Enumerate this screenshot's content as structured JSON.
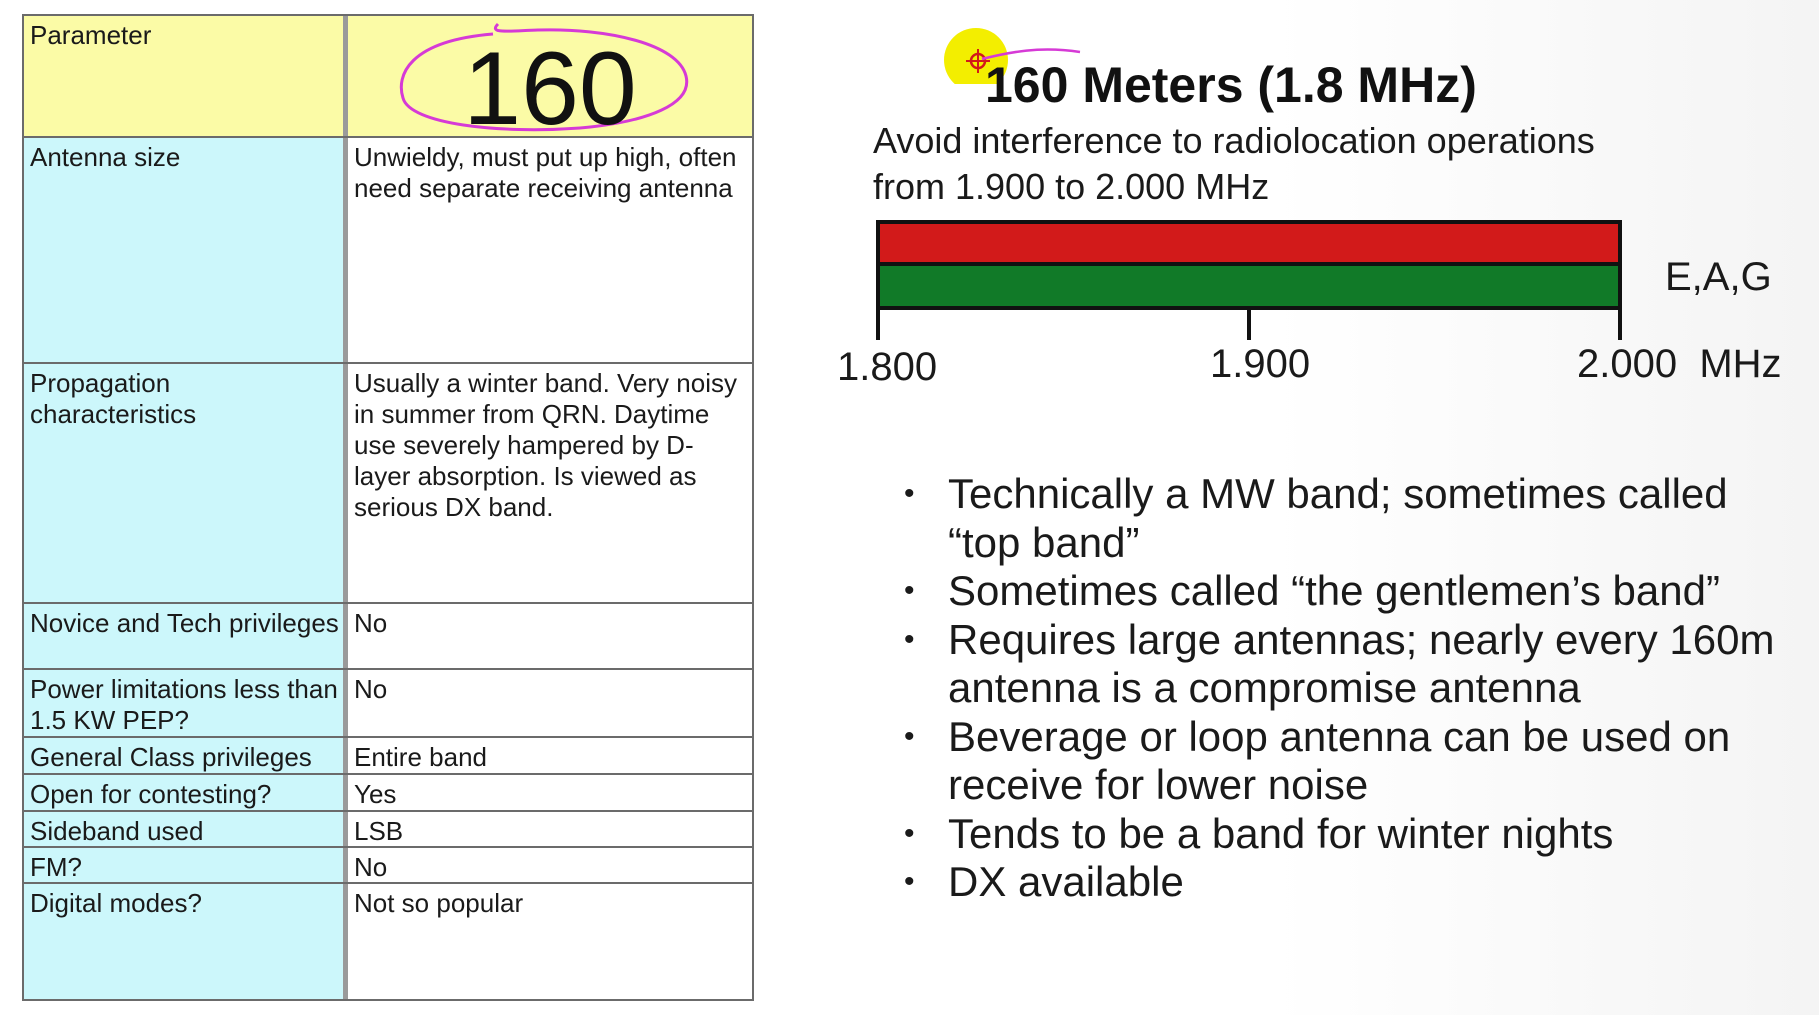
{
  "table": {
    "header": {
      "param_label": "Parameter",
      "band": "160"
    },
    "rows": [
      {
        "label": "Antenna size",
        "value": "Unwieldy, must put up high, often need separate receiving antenna"
      },
      {
        "label": "Propagation characteristics",
        "value": "Usually a winter band. Very noisy in summer from QRN. Daytime use severely hampered by D-layer absorption. Is viewed as serious DX band."
      },
      {
        "label": "Novice and Tech privileges",
        "value": "No"
      },
      {
        "label": "Power limitations less than 1.5 KW PEP?",
        "value": "No"
      },
      {
        "label": "General Class privileges",
        "value": "Entire band"
      },
      {
        "label": "Open for contesting?",
        "value": "Yes"
      },
      {
        "label": "Sideband used",
        "value": "LSB"
      },
      {
        "label": "FM?",
        "value": "No"
      },
      {
        "label": "Digital modes?",
        "value": "Not so popular"
      }
    ]
  },
  "slide": {
    "title": "160 Meters (1.8 MHz)",
    "subtitle": "Avoid interference to radiolocation operations from 1.900 to 2.000 MHz",
    "band_plan": {
      "privileges": "E,A,G",
      "ticks": [
        "1.800",
        "1.900",
        "2.000  MHz"
      ],
      "colors": {
        "upper": "#d21a1a",
        "lower": "#117a28"
      }
    },
    "bullets": [
      "Technically a MW band; sometimes called “top band”",
      "Sometimes called “the gentlemen’s band”",
      "Requires large antennas; nearly every 160m antenna is a compromise antenna",
      "Beverage or loop antenna can be used on receive for lower noise",
      "Tends to be a band for winter nights",
      "DX available"
    ]
  },
  "annotation_colors": {
    "circle": "#d63ad6",
    "highlight": "#f3ee00"
  }
}
